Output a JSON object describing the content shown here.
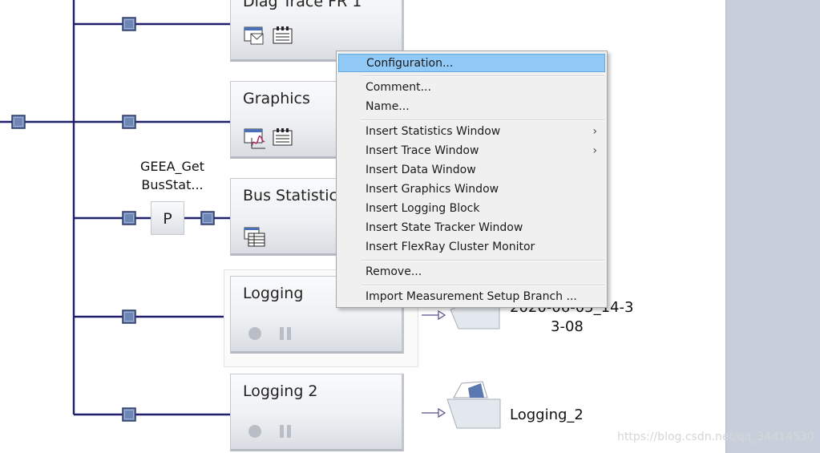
{
  "blocks": {
    "diag_trace": "Diag Trace FR 1",
    "graphics": "Graphics",
    "bus_stats": "Bus Statistics",
    "logging": "Logging",
    "logging2": "Logging 2"
  },
  "function_node": {
    "label_line1": "GEEA_Get",
    "label_line2": "BusStat...",
    "box_letter": "P"
  },
  "outputs": {
    "logging_line1": "2020-06-05_14-3",
    "logging_line2": "3-08",
    "logging2": "Logging_2"
  },
  "context_menu": {
    "items": [
      {
        "label": "Configuration...",
        "highlighted": true
      },
      {
        "label": "Comment..."
      },
      {
        "label": "Name..."
      },
      {
        "label": "Insert Statistics Window",
        "submenu": true
      },
      {
        "label": "Insert Trace Window",
        "submenu": true
      },
      {
        "label": "Insert Data Window"
      },
      {
        "label": "Insert Graphics Window"
      },
      {
        "label": "Insert Logging Block"
      },
      {
        "label": "Insert State Tracker Window"
      },
      {
        "label": "Insert FlexRay Cluster Monitor"
      },
      {
        "label": "Remove..."
      },
      {
        "label": "Import Measurement Setup Branch ..."
      }
    ],
    "submenu_arrow": "›"
  },
  "watermark": "https://blog.csdn.net/qq_34414530",
  "colors": {
    "wire": "#1f1f6e",
    "node_fill": "#6e86b5",
    "menu_highlight": "#91c9f7",
    "side_panel": "#c8cfdc"
  }
}
